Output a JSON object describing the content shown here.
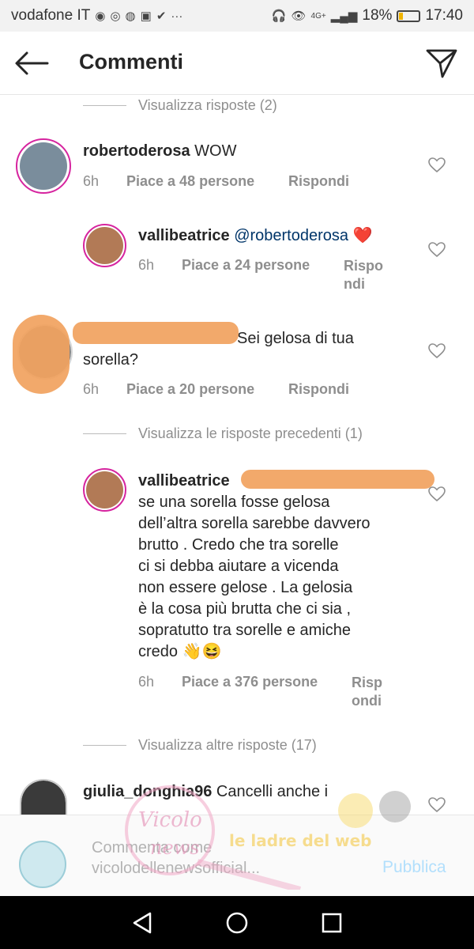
{
  "status_bar": {
    "carrier": "vodafone IT",
    "network": "4G+",
    "battery_percent": "18%",
    "battery_level": 0.18,
    "time": "17:40",
    "more": "···"
  },
  "header": {
    "title": "Commenti"
  },
  "comments": [
    {
      "type": "view_replies",
      "label": "Visualizza risposte (2)"
    },
    {
      "username": "robertoderosa",
      "text": "WOW",
      "time": "6h",
      "likes": "Piace a 48 persone",
      "reply": "Rispondi"
    },
    {
      "username": "vallibeatrice",
      "mention": "@robertoderosa",
      "emoji": "❤️",
      "time": "6h",
      "likes": "Piace a 24 persone",
      "reply_line1": "Rispo",
      "reply_line2": "ndi"
    },
    {
      "username": "",
      "text_line1": "Sei gelosa di tua",
      "text_line2": "sorella?",
      "time": "6h",
      "likes": "Piace a 20 persone",
      "reply": "Rispondi"
    },
    {
      "type": "view_replies",
      "label": "Visualizza le risposte precedenti (1)"
    },
    {
      "username": "vallibeatrice",
      "lines": [
        "se una sorella fosse gelosa",
        "dell’altra sorella sarebbe davvero",
        "brutto . Credo che tra sorelle",
        "ci si debba aiutare a vicenda",
        "non essere gelose . La gelosia",
        "è la cosa più brutta che ci sia ,",
        "sopratutto tra sorelle e amiche",
        "credo 👋😆"
      ],
      "time": "6h",
      "likes": "Piace a 376 persone",
      "reply_line1": "Risp",
      "reply_line2": "ondi"
    },
    {
      "type": "view_replies",
      "label": "Visualizza altre risposte (17)"
    },
    {
      "username": "giulia_donghia96",
      "text": "Cancelli anche i"
    }
  ],
  "composer": {
    "placeholder_line1": "Commenta come",
    "placeholder_line2": "vicolodellenewsofficial...",
    "publish_label": "Pubblica"
  },
  "watermark": {
    "text_top": "Vicolo",
    "text_bottom": "news",
    "text_right": "le ladre del web"
  },
  "colors": {
    "link": "#003569",
    "meta": "#8e8e8e",
    "publish_disabled": "#b2dffc",
    "redaction": "#f1a25e",
    "heart_emoji": "#e0245e"
  }
}
